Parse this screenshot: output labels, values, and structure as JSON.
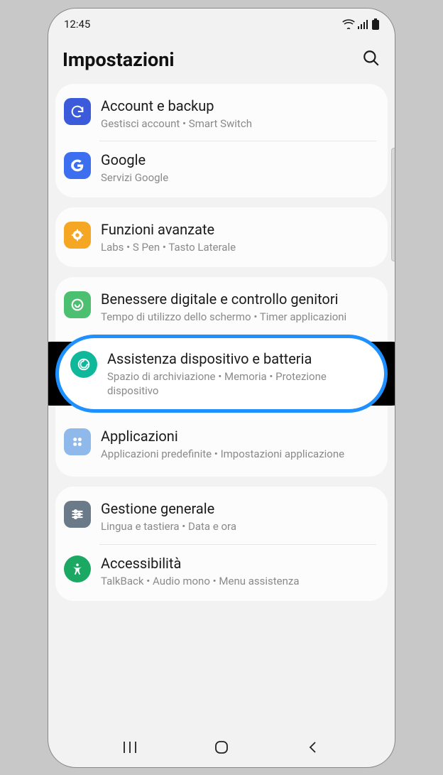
{
  "status": {
    "time": "12:45"
  },
  "header": {
    "title": "Impostazioni"
  },
  "groups": [
    {
      "items": [
        {
          "title": "Account e backup",
          "sub": "Gestisci account  •  Smart Switch",
          "icon": "backup",
          "color": "#3b5bdb"
        },
        {
          "title": "Google",
          "sub": "Servizi Google",
          "icon": "google",
          "color": "#3b6ff0"
        }
      ]
    },
    {
      "items": [
        {
          "title": "Funzioni avanzate",
          "sub": "Labs  •  S Pen  •  Tasto Laterale",
          "icon": "advanced",
          "color": "#f5a623"
        }
      ]
    },
    {
      "items": [
        {
          "title": "Benessere digitale e controllo genitori",
          "sub": "Tempo di utilizzo dello schermo  •  Timer applicazioni",
          "icon": "wellbeing",
          "color": "#4cbf70"
        },
        {
          "title": "Assistenza dispositivo e batteria",
          "sub": "Spazio di archiviazione  •  Memoria  •  Protezione dispositivo",
          "icon": "devicecare",
          "color": "#0fb89a",
          "highlight": true
        },
        {
          "title": "Applicazioni",
          "sub": "Applicazioni predefinite  •  Impostazioni applicazione",
          "icon": "apps",
          "color": "#8fb9ea"
        }
      ]
    },
    {
      "items": [
        {
          "title": "Gestione generale",
          "sub": "Lingua e tastiera  •  Data e ora",
          "icon": "general",
          "color": "#6b7a89"
        },
        {
          "title": "Accessibilità",
          "sub": "TalkBack  •  Audio mono  •  Menu assistenza",
          "icon": "accessibility",
          "color": "#1aa863"
        }
      ]
    }
  ]
}
